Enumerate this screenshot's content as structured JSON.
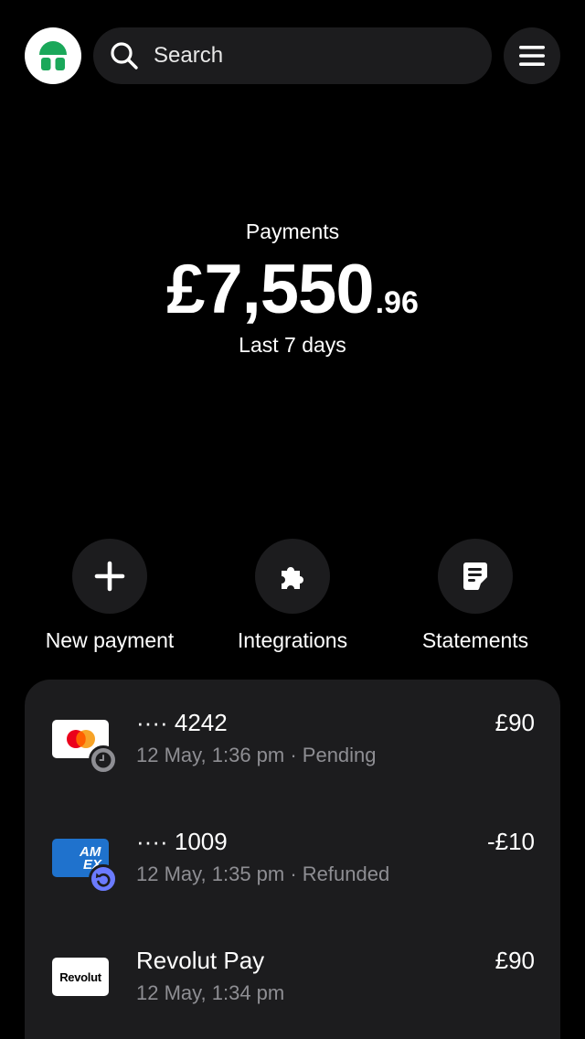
{
  "header": {
    "search_placeholder": "Search"
  },
  "summary": {
    "label": "Payments",
    "amount_main": "£7,550",
    "amount_cents": ".96",
    "period": "Last 7 days"
  },
  "actions": [
    {
      "label": "New payment",
      "icon": "plus-icon"
    },
    {
      "label": "Integrations",
      "icon": "puzzle-icon"
    },
    {
      "label": "Statements",
      "icon": "document-icon"
    }
  ],
  "transactions": [
    {
      "method": "mastercard",
      "title": "···· 4242",
      "subtitle": "12 May, 1:36 pm · Pending",
      "amount": "£90",
      "status": "pending"
    },
    {
      "method": "amex",
      "title": "···· 1009",
      "subtitle": "12 May, 1:35 pm · Refunded",
      "amount": "-£10",
      "status": "refunded"
    },
    {
      "method": "revolut",
      "logo_text": "Revolut",
      "title": "Revolut Pay",
      "subtitle": "12 May, 1:34 pm",
      "amount": "£90",
      "status": ""
    }
  ],
  "colors": {
    "background": "#000000",
    "surface": "#1c1c1e",
    "muted_text": "#8e8e93",
    "logo_green": "#1aa85a",
    "amex_blue": "#1f72cd",
    "refund_badge": "#6b7bff"
  }
}
